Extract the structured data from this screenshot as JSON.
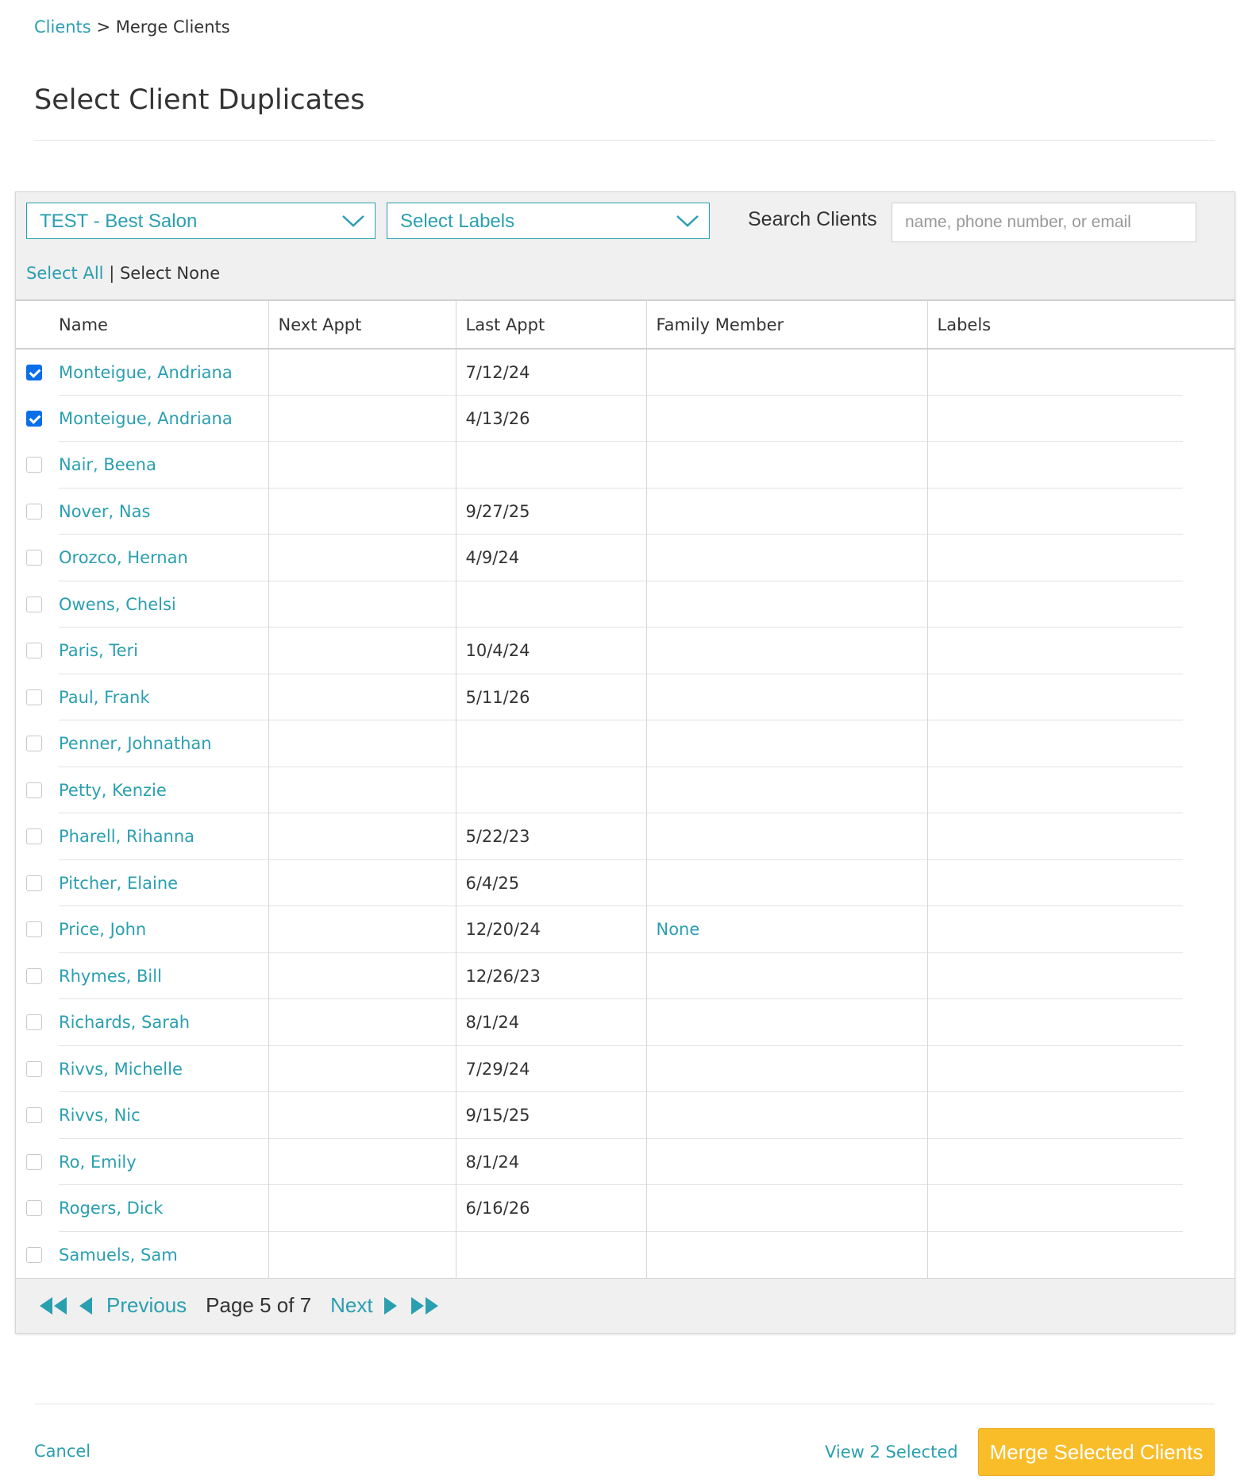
{
  "breadcrumb": {
    "root": "Clients",
    "separator": ">",
    "current": "Merge Clients"
  },
  "title": "Select Client Duplicates",
  "filters": {
    "salon": "TEST - Best Salon",
    "labels": "Select Labels",
    "search_label": "Search Clients",
    "search_placeholder": "name, phone number, or email"
  },
  "select_links": {
    "all": "Select All",
    "separator": "|",
    "none": "Select None"
  },
  "columns": [
    "Name",
    "Next Appt",
    "Last Appt",
    "Family Member",
    "Labels"
  ],
  "rows": [
    {
      "name": "Monteigue, Andriana",
      "next": "",
      "last": "7/12/24",
      "family": "",
      "labels": "",
      "checked": true
    },
    {
      "name": "Monteigue, Andriana",
      "next": "",
      "last": "4/13/26",
      "family": "",
      "labels": "",
      "checked": true
    },
    {
      "name": "Nair, Beena",
      "next": "",
      "last": "",
      "family": "",
      "labels": "",
      "checked": false
    },
    {
      "name": "Nover, Nas",
      "next": "",
      "last": "9/27/25",
      "family": "",
      "labels": "",
      "checked": false
    },
    {
      "name": "Orozco, Hernan",
      "next": "",
      "last": "4/9/24",
      "family": "",
      "labels": "",
      "checked": false
    },
    {
      "name": "Owens, Chelsi",
      "next": "",
      "last": "",
      "family": "",
      "labels": "",
      "checked": false
    },
    {
      "name": "Paris, Teri",
      "next": "",
      "last": "10/4/24",
      "family": "",
      "labels": "",
      "checked": false
    },
    {
      "name": "Paul, Frank",
      "next": "",
      "last": "5/11/26",
      "family": "",
      "labels": "",
      "checked": false
    },
    {
      "name": "Penner, Johnathan",
      "next": "",
      "last": "",
      "family": "",
      "labels": "",
      "checked": false
    },
    {
      "name": "Petty, Kenzie",
      "next": "",
      "last": "",
      "family": "",
      "labels": "",
      "checked": false
    },
    {
      "name": "Pharell, Rihanna",
      "next": "",
      "last": "5/22/23",
      "family": "",
      "labels": "",
      "checked": false
    },
    {
      "name": "Pitcher, Elaine",
      "next": "",
      "last": "6/4/25",
      "family": "",
      "labels": "",
      "checked": false
    },
    {
      "name": "Price, John",
      "next": "",
      "last": "12/20/24",
      "family": "None",
      "labels": "",
      "checked": false
    },
    {
      "name": "Rhymes, Bill",
      "next": "",
      "last": "12/26/23",
      "family": "",
      "labels": "",
      "checked": false
    },
    {
      "name": "Richards, Sarah",
      "next": "",
      "last": "8/1/24",
      "family": "",
      "labels": "",
      "checked": false
    },
    {
      "name": "Rivvs, Michelle",
      "next": "",
      "last": "7/29/24",
      "family": "",
      "labels": "",
      "checked": false
    },
    {
      "name": "Rivvs, Nic",
      "next": "",
      "last": "9/15/25",
      "family": "",
      "labels": "",
      "checked": false
    },
    {
      "name": "Ro, Emily",
      "next": "",
      "last": "8/1/24",
      "family": "",
      "labels": "",
      "checked": false
    },
    {
      "name": "Rogers, Dick",
      "next": "",
      "last": "6/16/26",
      "family": "",
      "labels": "",
      "checked": false
    },
    {
      "name": "Samuels, Sam",
      "next": "",
      "last": "",
      "family": "",
      "labels": "",
      "checked": false
    }
  ],
  "pager": {
    "previous": "Previous",
    "page_info": "Page 5 of 7",
    "next": "Next"
  },
  "footer": {
    "cancel": "Cancel",
    "view_selected": "View 2 Selected",
    "merge": "Merge Selected Clients"
  },
  "colors": {
    "accent": "#2a9fb0",
    "merge_button": "#f9bd2a",
    "checkbox_checked": "#0a6ee8"
  }
}
